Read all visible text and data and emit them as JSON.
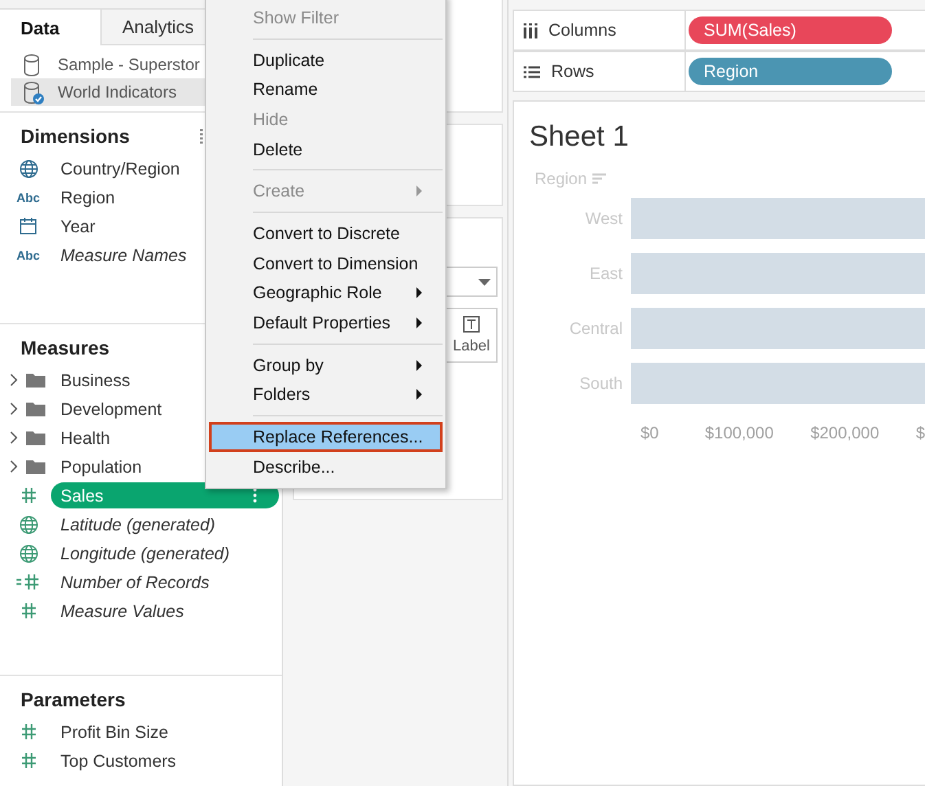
{
  "data_pane": {
    "tabs": [
      {
        "label": "Data",
        "selected": true
      },
      {
        "label": "Analytics",
        "selected": false
      }
    ],
    "sources": [
      {
        "name": "Sample - Superstor",
        "selected": false,
        "live": false
      },
      {
        "name": "World Indicators",
        "selected": true,
        "live": true
      }
    ],
    "sections": [
      {
        "title": "Dimensions",
        "handle": true,
        "items": [
          {
            "kind": "globe",
            "name": "Country/Region",
            "italic": false
          },
          {
            "kind": "text",
            "type_label": "Abc",
            "name": "Region",
            "italic": false
          },
          {
            "kind": "calendar",
            "name": "Year",
            "italic": false
          },
          {
            "kind": "text",
            "type_label": "Abc",
            "name": "Measure Names",
            "italic": true
          }
        ]
      },
      {
        "title": "Measures",
        "handle": false,
        "items": [
          {
            "kind": "folder",
            "name": "Business",
            "expanded": false
          },
          {
            "kind": "folder",
            "name": "Development",
            "expanded": false
          },
          {
            "kind": "folder",
            "name": "Health",
            "expanded": false
          },
          {
            "kind": "folder",
            "name": "Population",
            "expanded": false
          },
          {
            "kind": "number",
            "name": "Sales",
            "italic": false,
            "selected": true
          },
          {
            "kind": "geo",
            "name": "Latitude (generated)",
            "italic": true
          },
          {
            "kind": "geo",
            "name": "Longitude (generated)",
            "italic": true
          },
          {
            "kind": "count",
            "name": "Number of Records",
            "italic": true
          },
          {
            "kind": "number",
            "name": "Measure Values",
            "italic": true
          }
        ]
      },
      {
        "title": "Parameters",
        "handle": false,
        "items": [
          {
            "kind": "number",
            "name": "Profit Bin Size",
            "italic": false
          },
          {
            "kind": "number",
            "name": "Top Customers",
            "italic": false
          }
        ]
      }
    ]
  },
  "marks_card": {
    "mark_buttons": [
      {
        "label": "Label",
        "kind": "text"
      }
    ]
  },
  "shelves": [
    {
      "label": "Columns",
      "kind": "columns",
      "pill": {
        "text": "SUM(Sales)",
        "color": "#e8475a"
      }
    },
    {
      "label": "Rows",
      "kind": "rows",
      "pill": {
        "text": "Region",
        "color": "#4b95b2"
      }
    }
  ],
  "sheet": {
    "title": "Sheet 1",
    "row_header": "Region",
    "categories": [
      "West",
      "East",
      "Central",
      "South"
    ],
    "axis_ticks": [
      "$0",
      "$100,000",
      "$200,000",
      "$"
    ]
  },
  "context_menu": [
    {
      "kind": "item",
      "label": "Show Filter",
      "disabled": true,
      "submenu": false,
      "selected": false
    },
    {
      "kind": "separator"
    },
    {
      "kind": "item",
      "label": "Duplicate",
      "disabled": false,
      "submenu": false,
      "selected": false
    },
    {
      "kind": "item",
      "label": "Rename",
      "disabled": false,
      "submenu": false,
      "selected": false
    },
    {
      "kind": "item",
      "label": "Hide",
      "disabled": true,
      "submenu": false,
      "selected": false
    },
    {
      "kind": "item",
      "label": "Delete",
      "disabled": false,
      "submenu": false,
      "selected": false
    },
    {
      "kind": "separator"
    },
    {
      "kind": "item",
      "label": "Create",
      "disabled": true,
      "submenu": true,
      "selected": false
    },
    {
      "kind": "separator"
    },
    {
      "kind": "item",
      "label": "Convert to Discrete",
      "disabled": false,
      "submenu": false,
      "selected": false
    },
    {
      "kind": "item",
      "label": "Convert to Dimension",
      "disabled": false,
      "submenu": false,
      "selected": false
    },
    {
      "kind": "item",
      "label": "Geographic Role",
      "disabled": false,
      "submenu": true,
      "selected": false
    },
    {
      "kind": "item",
      "label": "Default Properties",
      "disabled": false,
      "submenu": true,
      "selected": false
    },
    {
      "kind": "separator"
    },
    {
      "kind": "item",
      "label": "Group by",
      "disabled": false,
      "submenu": true,
      "selected": false
    },
    {
      "kind": "item",
      "label": "Folders",
      "disabled": false,
      "submenu": true,
      "selected": false
    },
    {
      "kind": "separator"
    },
    {
      "kind": "item",
      "label": "Replace References...",
      "disabled": false,
      "submenu": false,
      "selected": true
    },
    {
      "kind": "item",
      "label": "Describe...",
      "disabled": false,
      "submenu": false,
      "selected": false
    }
  ]
}
